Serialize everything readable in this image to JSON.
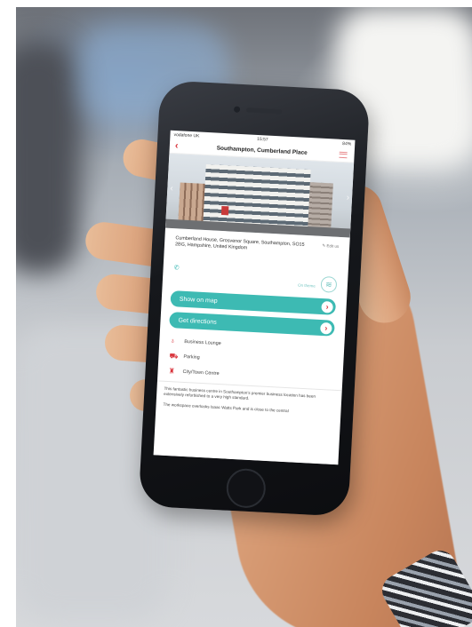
{
  "status_bar": {
    "carrier": "vodafone UK",
    "time": "15:57",
    "battery": "84%"
  },
  "navbar": {
    "title": "Southampton, Cumberland Place"
  },
  "location": {
    "address": "Cumberland House, Grosvenor Square, Southampton, SO15 2BG, Hampshire, United Kingdom",
    "edit_label": "Edit us",
    "on_theme_label": "On theme"
  },
  "actions": {
    "show_on_map": "Show on map",
    "get_directions": "Get directions"
  },
  "facilities": [
    {
      "label": "Business Lounge",
      "icon": "lightbulb-icon"
    },
    {
      "label": "Parking",
      "icon": "car-icon"
    },
    {
      "label": "City/Town Centre",
      "icon": "building-icon"
    }
  ],
  "description": {
    "paragraph1": "This fantastic business centre in Southampton's premier business location has been extensively refurbished to a very high standard.",
    "paragraph2": "The workspace overlooks Isaac Watts Park and is close to the central"
  },
  "colors": {
    "accent_teal": "#3dbab3",
    "accent_red": "#d9363e"
  }
}
